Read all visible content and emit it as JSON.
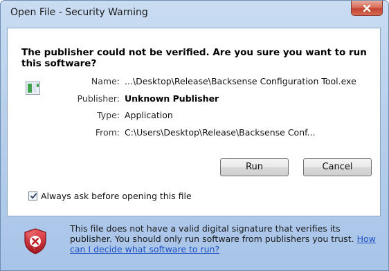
{
  "window": {
    "title": "Open File - Security Warning"
  },
  "warning": {
    "headline": "The publisher could not be verified.  Are you sure you want to run this software?"
  },
  "details": [
    {
      "label": "Name:",
      "value": "...\\Desktop\\Release\\Backsense Configuration Tool.exe"
    },
    {
      "label": "Publisher:",
      "value": "Unknown Publisher"
    },
    {
      "label": "Type:",
      "value": "Application"
    },
    {
      "label": "From:",
      "value": "C:\\Users\\Desktop\\Release\\Backsense Conf..."
    }
  ],
  "buttons": {
    "run": "Run",
    "cancel": "Cancel"
  },
  "checkbox": {
    "label": "Always ask before opening this file",
    "checked": true
  },
  "footer": {
    "text": "This file does not have a valid digital signature that verifies its publisher. You should only run software from publishers you trust.",
    "link": "How can I decide what software to run?"
  },
  "icons": {
    "close": "close-icon",
    "file": "application-file-icon",
    "check": "checkmark-icon",
    "shield": "security-shield-error-icon"
  },
  "colors": {
    "titlebar": "#b7cfec",
    "close_button": "#c4452f",
    "link": "#1c4fc4",
    "shield": "#c0262c"
  }
}
